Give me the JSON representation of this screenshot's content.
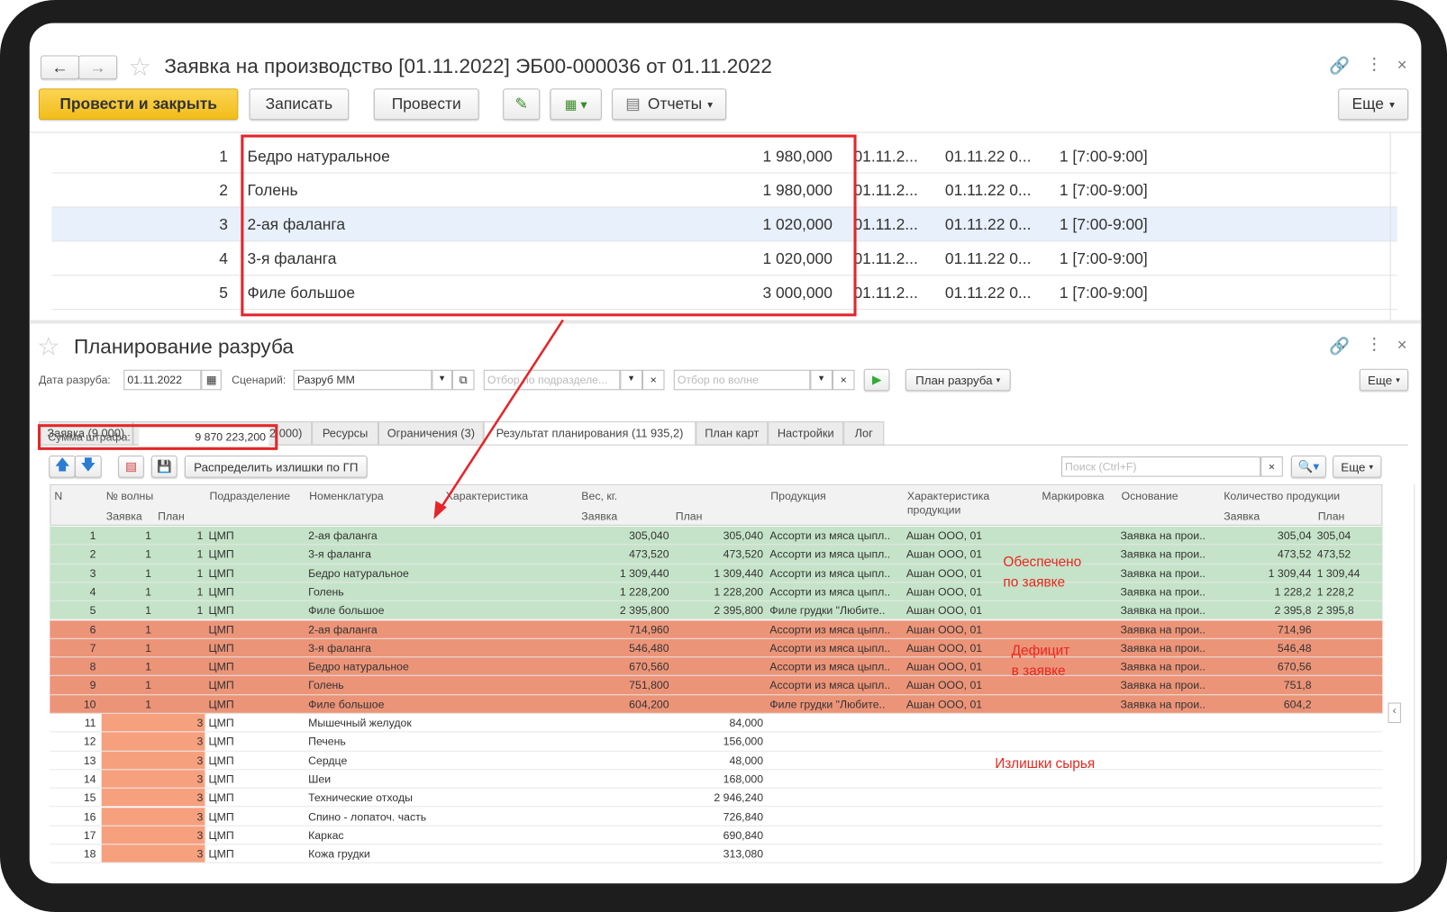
{
  "window": {
    "title": "Заявка на производство [01.11.2022] ЭБ00-000036 от 01.11.2022"
  },
  "toolbar": {
    "post_close": "Провести и закрыть",
    "save": "Записать",
    "post": "Провести",
    "reports": "Отчеты",
    "more": "Еще"
  },
  "top_table": {
    "rows": [
      {
        "n": "1",
        "name": "Бедро натуральное",
        "qty": "1 980,000",
        "d1": "01.11.2...",
        "d2": "01.11.22 0...",
        "slot": "1 [7:00-9:00]"
      },
      {
        "n": "2",
        "name": "Голень",
        "qty": "1 980,000",
        "d1": "01.11.2...",
        "d2": "01.11.22 0...",
        "slot": "1 [7:00-9:00]"
      },
      {
        "n": "3",
        "name": "2-ая фаланга",
        "qty": "1 020,000",
        "d1": "01.11.2...",
        "d2": "01.11.22 0...",
        "slot": "1 [7:00-9:00]"
      },
      {
        "n": "4",
        "name": "3-я фаланга",
        "qty": "1 020,000",
        "d1": "01.11.2...",
        "d2": "01.11.22 0...",
        "slot": "1 [7:00-9:00]"
      },
      {
        "n": "5",
        "name": "Филе большое",
        "qty": "3 000,000",
        "d1": "01.11.2...",
        "d2": "01.11.22 0...",
        "slot": "1 [7:00-9:00]"
      }
    ],
    "selected_row": 3
  },
  "planning": {
    "title": "Планирование разруба",
    "date_label": "Дата разруба:",
    "date_value": "01.11.2022",
    "scenario_label": "Сценарий:",
    "scenario_value": "Разруб ММ",
    "dept_filter_placeholder": "Отбор по подразделе...",
    "wave_filter_placeholder": "Отбор по волне",
    "plan_button": "План разруба",
    "more": "Еще",
    "tabs": [
      "Заявка (9 000)",
      "Начальные значения (12 000)",
      "Ресурсы",
      "Ограничения (3)",
      "Результат планирования (11 935,2)",
      "План карт",
      "Настройки",
      "Лог"
    ],
    "active_tab": 4,
    "penalty_label": "Сумма штрафа:",
    "penalty_value": "9 870 223,200",
    "distribute_button": "Распределить излишки по ГП",
    "search_placeholder": "Поиск (Ctrl+F)",
    "headers": {
      "n": "N",
      "wave": "№ волны",
      "wave_req": "Заявка",
      "wave_plan": "План",
      "dept": "Подразделение",
      "nom": "Номенклатура",
      "char": "Характеристика",
      "weight": "Вес, кг.",
      "w_req": "Заявка",
      "w_plan": "План",
      "product": "Продукция",
      "prod_char": "Характеристика продукции",
      "marking": "Маркировка",
      "basis": "Основание",
      "qty": "Количество продукции",
      "q_req": "Заявка",
      "q_plan": "План"
    },
    "colors": {
      "green": "#c5e3c8",
      "orange": "#ec9478",
      "surplus": "#f7a07e",
      "annotation": "#e8271f"
    },
    "rows": [
      {
        "n": "1",
        "wr": "1",
        "wp": "1",
        "dept": "ЦМП",
        "nom": "2-ая фаланга",
        "w_req": "305,040",
        "w_plan": "305,040",
        "prod": "Ассорти из мяса цыпл..",
        "pchar": "Ашан ООО, 01",
        "basis": "Заявка на прои..",
        "q_req": "305,04",
        "q_plan": "305,04",
        "status": "green"
      },
      {
        "n": "2",
        "wr": "1",
        "wp": "1",
        "dept": "ЦМП",
        "nom": "3-я фаланга",
        "w_req": "473,520",
        "w_plan": "473,520",
        "prod": "Ассорти из мяса цыпл..",
        "pchar": "Ашан ООО, 01",
        "basis": "Заявка на прои..",
        "q_req": "473,52",
        "q_plan": "473,52",
        "status": "green"
      },
      {
        "n": "3",
        "wr": "1",
        "wp": "1",
        "dept": "ЦМП",
        "nom": "Бедро натуральное",
        "w_req": "1 309,440",
        "w_plan": "1 309,440",
        "prod": "Ассорти из мяса цыпл..",
        "pchar": "Ашан ООО, 01",
        "basis": "Заявка на прои..",
        "q_req": "1 309,44",
        "q_plan": "1 309,44",
        "status": "green"
      },
      {
        "n": "4",
        "wr": "1",
        "wp": "1",
        "dept": "ЦМП",
        "nom": "Голень",
        "w_req": "1 228,200",
        "w_plan": "1 228,200",
        "prod": "Ассорти из мяса цыпл..",
        "pchar": "Ашан ООО, 01",
        "basis": "Заявка на прои..",
        "q_req": "1 228,2",
        "q_plan": "1 228,2",
        "status": "green"
      },
      {
        "n": "5",
        "wr": "1",
        "wp": "1",
        "dept": "ЦМП",
        "nom": "Филе большое",
        "w_req": "2 395,800",
        "w_plan": "2 395,800",
        "prod": "Филе грудки \"Любите..",
        "pchar": "Ашан ООО, 01",
        "basis": "Заявка на прои..",
        "q_req": "2 395,8",
        "q_plan": "2 395,8",
        "status": "green"
      },
      {
        "n": "6",
        "wr": "1",
        "wp": "",
        "dept": "ЦМП",
        "nom": "2-ая фаланга",
        "w_req": "714,960",
        "w_plan": "",
        "prod": "Ассорти из мяса цыпл..",
        "pchar": "Ашан ООО, 01",
        "basis": "Заявка на прои..",
        "q_req": "714,96",
        "q_plan": "",
        "status": "orange"
      },
      {
        "n": "7",
        "wr": "1",
        "wp": "",
        "dept": "ЦМП",
        "nom": "3-я фаланга",
        "w_req": "546,480",
        "w_plan": "",
        "prod": "Ассорти из мяса цыпл..",
        "pchar": "Ашан ООО, 01",
        "basis": "Заявка на прои..",
        "q_req": "546,48",
        "q_plan": "",
        "status": "orange"
      },
      {
        "n": "8",
        "wr": "1",
        "wp": "",
        "dept": "ЦМП",
        "nom": "Бедро натуральное",
        "w_req": "670,560",
        "w_plan": "",
        "prod": "Ассорти из мяса цыпл..",
        "pchar": "Ашан ООО, 01",
        "basis": "Заявка на прои..",
        "q_req": "670,56",
        "q_plan": "",
        "status": "orange"
      },
      {
        "n": "9",
        "wr": "1",
        "wp": "",
        "dept": "ЦМП",
        "nom": "Голень",
        "w_req": "751,800",
        "w_plan": "",
        "prod": "Ассорти из мяса цыпл..",
        "pchar": "Ашан ООО, 01",
        "basis": "Заявка на прои..",
        "q_req": "751,8",
        "q_plan": "",
        "status": "orange"
      },
      {
        "n": "10",
        "wr": "1",
        "wp": "",
        "dept": "ЦМП",
        "nom": "Филе большое",
        "w_req": "604,200",
        "w_plan": "",
        "prod": "Филе грудки \"Любите..",
        "pchar": "Ашан ООО, 01",
        "basis": "Заявка на прои..",
        "q_req": "604,2",
        "q_plan": "",
        "status": "orange"
      },
      {
        "n": "11",
        "wr": "",
        "wp": "3",
        "dept": "ЦМП",
        "nom": "Мышечный желудок",
        "w_req": "",
        "w_plan": "84,000",
        "status": "surplus"
      },
      {
        "n": "12",
        "wr": "",
        "wp": "3",
        "dept": "ЦМП",
        "nom": "Печень",
        "w_req": "",
        "w_plan": "156,000",
        "status": "surplus"
      },
      {
        "n": "13",
        "wr": "",
        "wp": "3",
        "dept": "ЦМП",
        "nom": "Сердце",
        "w_req": "",
        "w_plan": "48,000",
        "status": "surplus"
      },
      {
        "n": "14",
        "wr": "",
        "wp": "3",
        "dept": "ЦМП",
        "nom": "Шеи",
        "w_req": "",
        "w_plan": "168,000",
        "status": "surplus"
      },
      {
        "n": "15",
        "wr": "",
        "wp": "3",
        "dept": "ЦМП",
        "nom": "Технические отходы",
        "w_req": "",
        "w_plan": "2 946,240",
        "status": "surplus"
      },
      {
        "n": "16",
        "wr": "",
        "wp": "3",
        "dept": "ЦМП",
        "nom": "Спино - лопаточ. часть",
        "w_req": "",
        "w_plan": "726,840",
        "status": "surplus"
      },
      {
        "n": "17",
        "wr": "",
        "wp": "3",
        "dept": "ЦМП",
        "nom": "Каркас",
        "w_req": "",
        "w_plan": "690,840",
        "status": "surplus"
      },
      {
        "n": "18",
        "wr": "",
        "wp": "3",
        "dept": "ЦМП",
        "nom": "Кожа грудки",
        "w_req": "",
        "w_plan": "313,080",
        "status": "surplus"
      }
    ]
  },
  "annotations": {
    "provided": "Обеспечено\nпо заявке",
    "deficit": "Дефицит\nв заявке",
    "surplus": "Излишки сырья"
  }
}
